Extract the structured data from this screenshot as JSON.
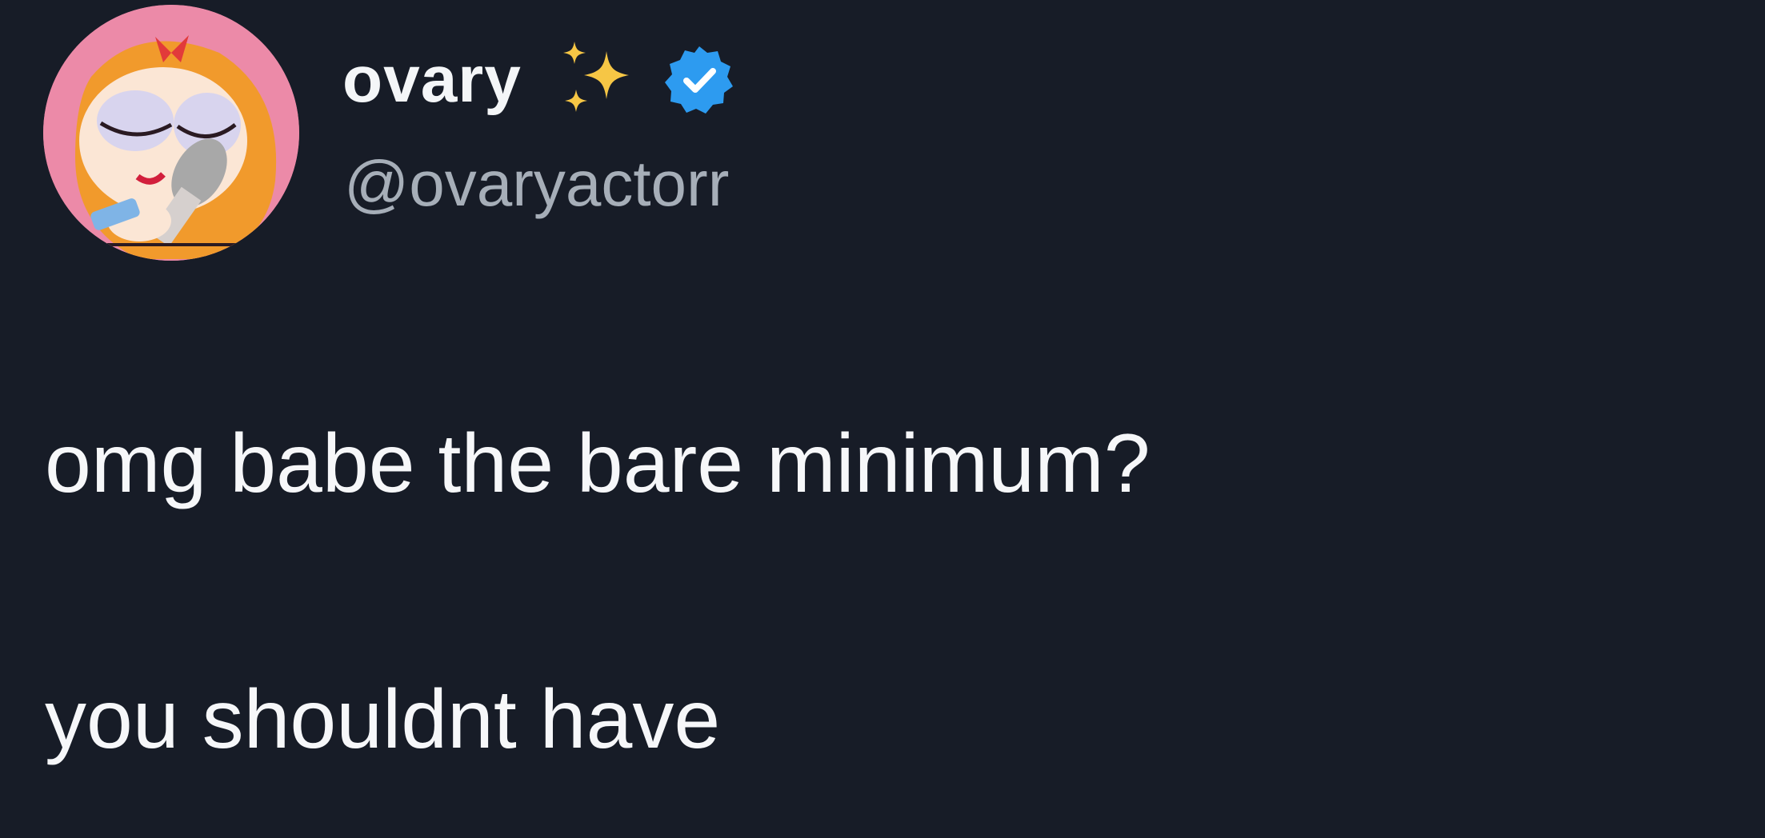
{
  "tweet": {
    "display_name": "ovary",
    "handle": "@ovaryactorr",
    "verified": true,
    "name_emoji": "sparkles-icon",
    "text_lines": [
      "omg babe the bare minimum?",
      "you shouldnt have"
    ],
    "avatar_icon": "cartoon-character-avatar"
  },
  "colors": {
    "background": "#171c27",
    "text": "#f6f7f9",
    "handle": "#a6aeb8",
    "verified_badge": "#2d9bf0",
    "sparkles": "#f6c645",
    "avatar_bg": "#ec8aa8"
  }
}
